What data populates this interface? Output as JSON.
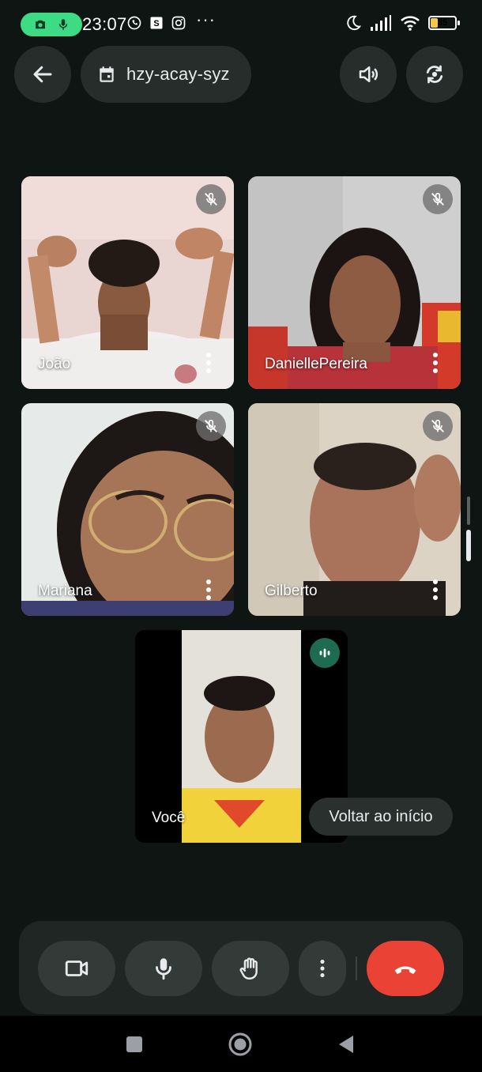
{
  "status_bar": {
    "time": "23:07",
    "battery": "35",
    "battery_level": 0.35,
    "icons": [
      "screen-record-camera-icon",
      "mic-icon",
      "whatsapp-icon",
      "s-app-icon",
      "instagram-icon",
      "more-dots-icon",
      "moon-icon",
      "signal-icon",
      "wifi-icon",
      "battery-icon"
    ],
    "more_dots": "···"
  },
  "top_bar": {
    "meeting_code": "hzy-acay-syz",
    "icons": [
      "back-arrow-icon",
      "calendar-icon",
      "speaker-icon",
      "switch-camera-icon"
    ]
  },
  "participants": [
    {
      "name": "João",
      "muted": true
    },
    {
      "name": "DaniellePereira",
      "muted": true
    },
    {
      "name": "Mariana",
      "muted": true
    },
    {
      "name": "Gilberto",
      "muted": true
    }
  ],
  "self_tile": {
    "name": "Você",
    "speaking": true
  },
  "back_to_start": "Voltar ao início",
  "controls": {
    "icons": [
      "camera-icon",
      "mic-icon",
      "raise-hand-icon",
      "more-options-icon",
      "end-call-icon"
    ]
  },
  "navbar": {
    "icons": [
      "recents-square-icon",
      "home-circle-icon",
      "back-triangle-icon"
    ]
  },
  "colors": {
    "background": "#0f1512",
    "button": "#343a37",
    "end_call": "#ea4335",
    "speaking": "#1e6b52",
    "record_pill": "#3ddc84"
  }
}
